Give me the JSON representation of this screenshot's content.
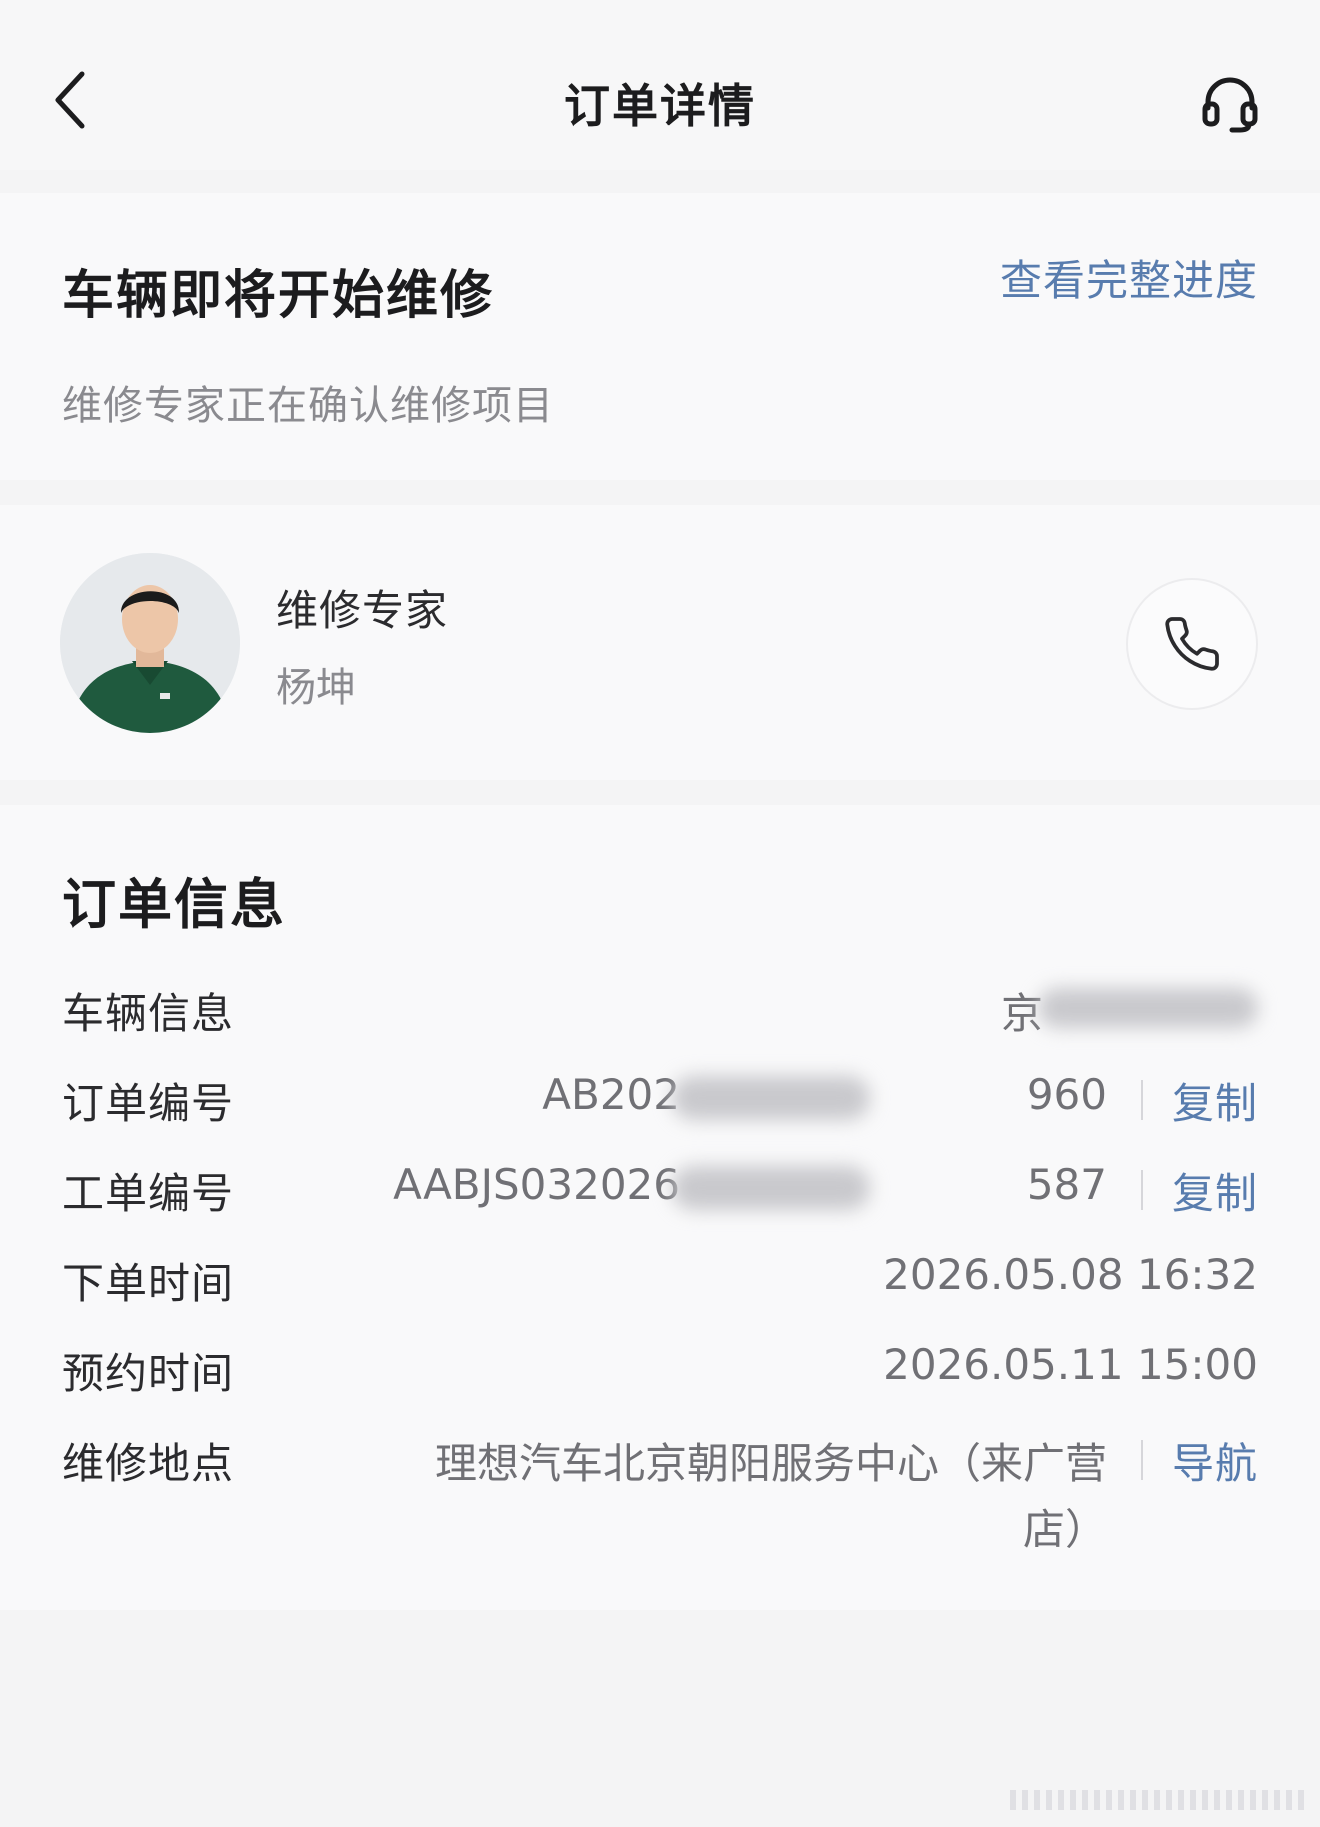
{
  "nav": {
    "title": "订单详情",
    "back_icon": "chevron-left-icon",
    "support_icon": "headset-icon"
  },
  "status": {
    "title": "车辆即将开始维修",
    "link": "查看完整进度",
    "subtitle": "维修专家正在确认维修项目"
  },
  "expert": {
    "role": "维修专家",
    "name": "杨坤",
    "call_icon": "phone-icon"
  },
  "order": {
    "heading": "订单信息",
    "vehicle": {
      "label": "车辆信息",
      "value_visible": "京"
    },
    "order_no": {
      "label": "订单编号",
      "prefix": "AB202",
      "suffix": "960",
      "action": "复制"
    },
    "work_no": {
      "label": "工单编号",
      "prefix": "AABJS032026",
      "suffix": "587",
      "action": "复制"
    },
    "order_time": {
      "label": "下单时间",
      "value": "2026.05.08 16:32"
    },
    "appointment_time": {
      "label": "预约时间",
      "value": "2026.05.11 15:00"
    },
    "location": {
      "label": "维修地点",
      "line1": "理想汽车北京朝阳服务中心（来广营",
      "line2": "店）",
      "action": "导航"
    }
  },
  "colors": {
    "accent": "#587cae",
    "background": "#f4f4f5",
    "card": "#f9f9fa",
    "text": "#1c1c1e",
    "muted": "#8a8a8f"
  }
}
